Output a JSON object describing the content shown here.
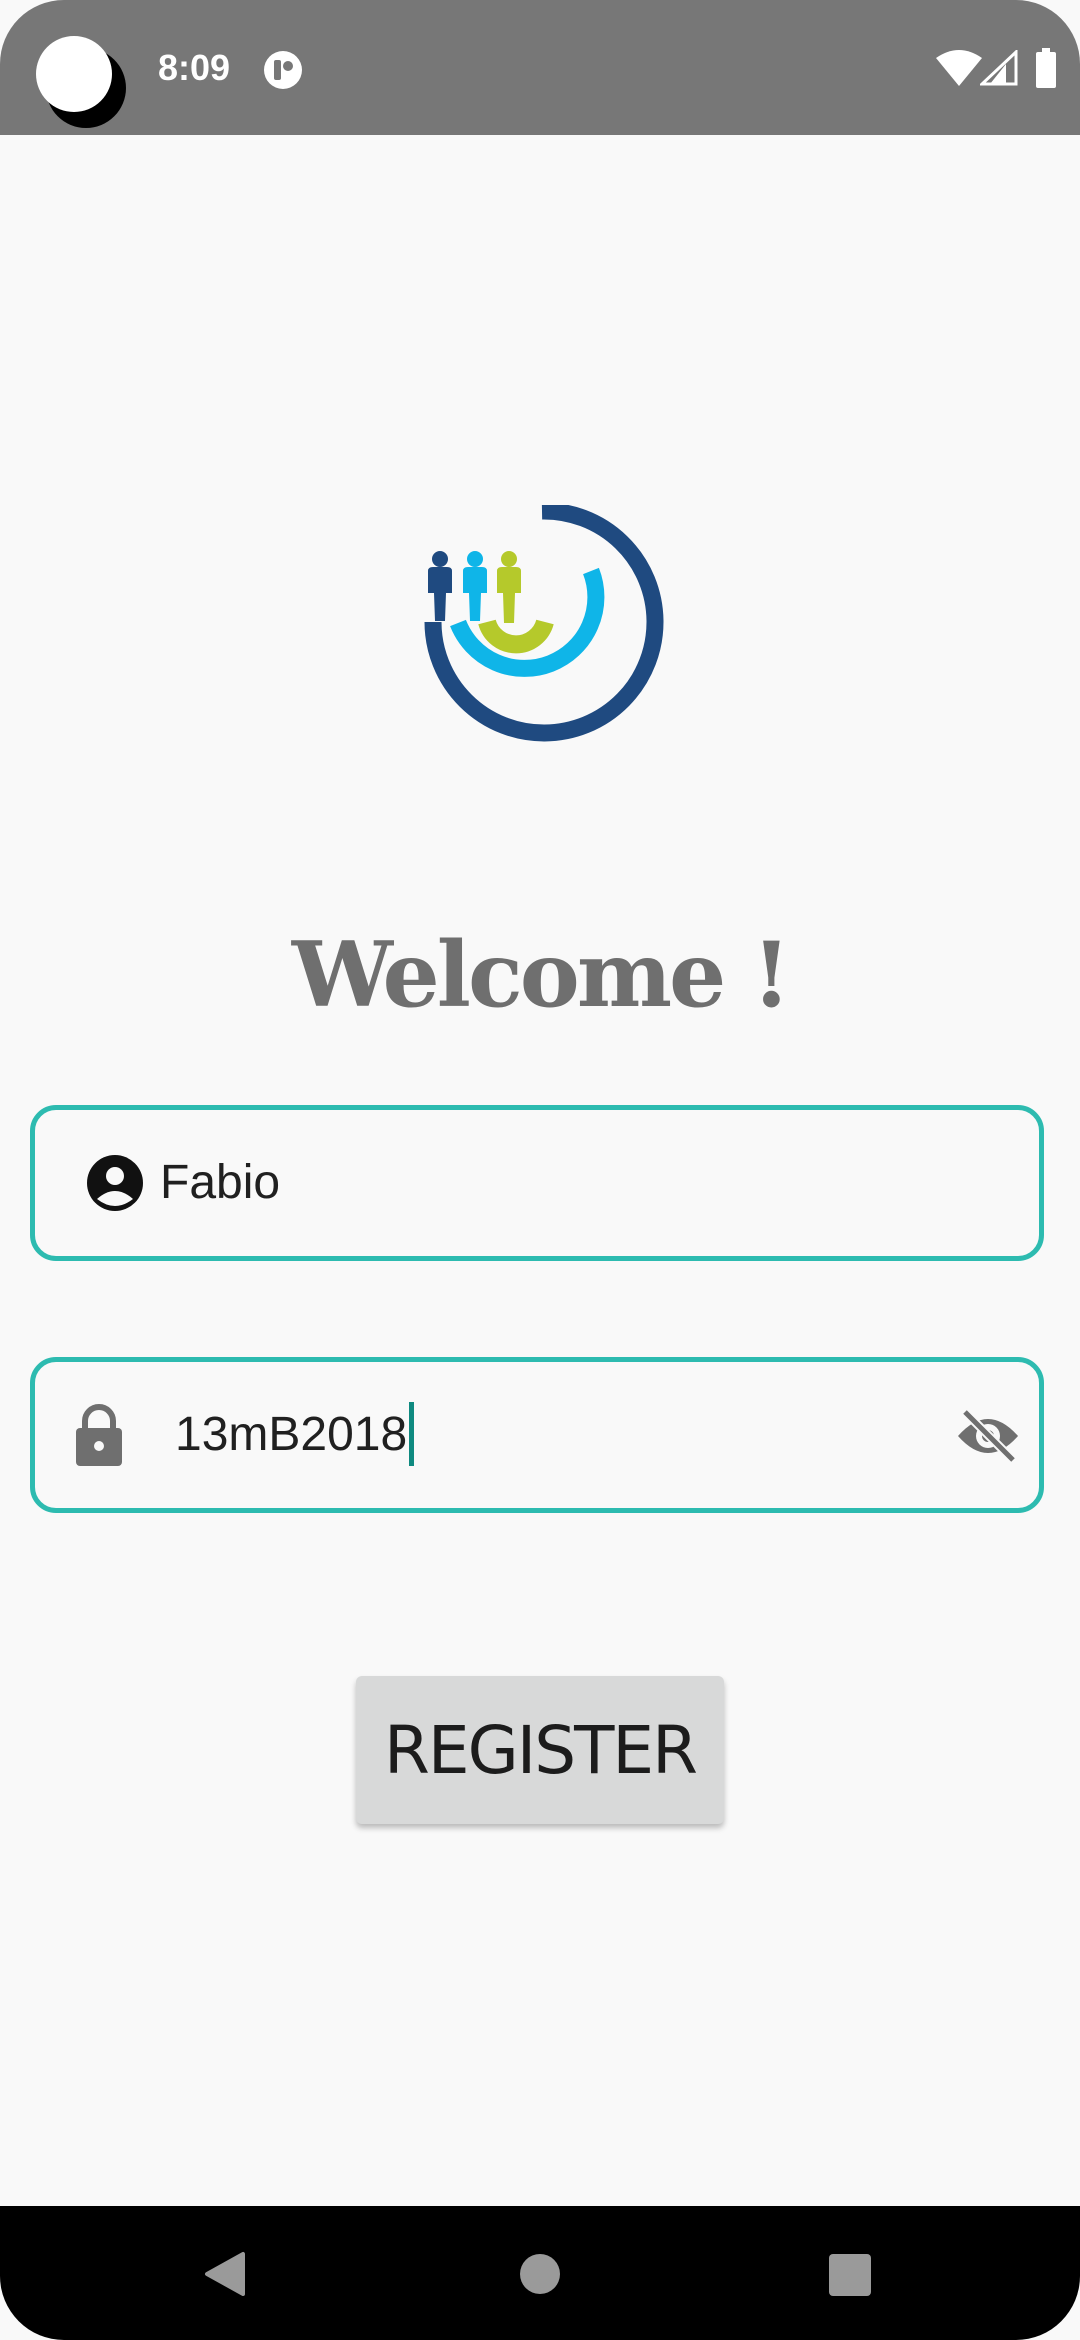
{
  "status_bar": {
    "time": "8:09",
    "icons": [
      "camera-cutout",
      "app-notification-icon",
      "wifi-icon",
      "signal-icon",
      "battery-icon"
    ],
    "background": "#777777"
  },
  "logo": {
    "colors": {
      "dark_blue": "#1f4a80",
      "light_blue": "#0fb5e8",
      "green": "#b5c92b"
    }
  },
  "welcome": {
    "title": "Welcome !"
  },
  "username_field": {
    "value": "Fabio",
    "icon": "person-icon"
  },
  "password_field": {
    "value": "13mB2018",
    "leading_icon": "lock-icon",
    "trailing_icon": "visibility-off-icon",
    "focused": true
  },
  "register_button": {
    "label": "REGISTER"
  },
  "nav_bar": {
    "buttons": [
      "back",
      "home",
      "recents"
    ]
  },
  "colors": {
    "accent": "#2dbbb0",
    "background": "#f9f9f9",
    "button_bg": "#d8d9d9",
    "title": "#6f6f6f"
  }
}
